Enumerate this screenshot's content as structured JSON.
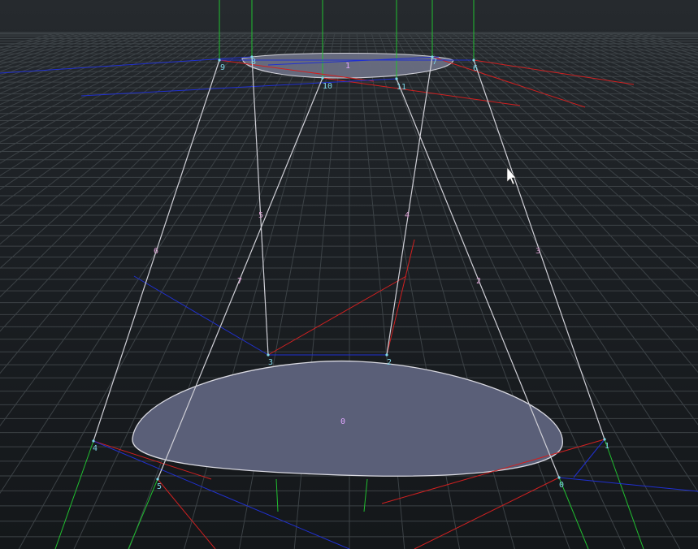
{
  "colors": {
    "background": "#1e2226",
    "grid": "#3c4246",
    "face_fill": "#5a5f78",
    "face_edge": "#d8d8e0",
    "edge_line": "#cfcfd6",
    "axis_x": "#d02020",
    "axis_y": "#20c030",
    "axis_z": "#2030d0",
    "point_label": "#7fd7e8",
    "edge_label": "#d89ccf"
  },
  "face_labels": [
    "0",
    "1"
  ],
  "point_labels": [
    "0",
    "1",
    "2",
    "3",
    "4",
    "5",
    "6",
    "7",
    "8",
    "9",
    "10",
    "11"
  ],
  "edge_labels": [
    "2",
    "3",
    "4",
    "5",
    "6",
    "7"
  ],
  "cursor": "mouse-pointer-icon"
}
